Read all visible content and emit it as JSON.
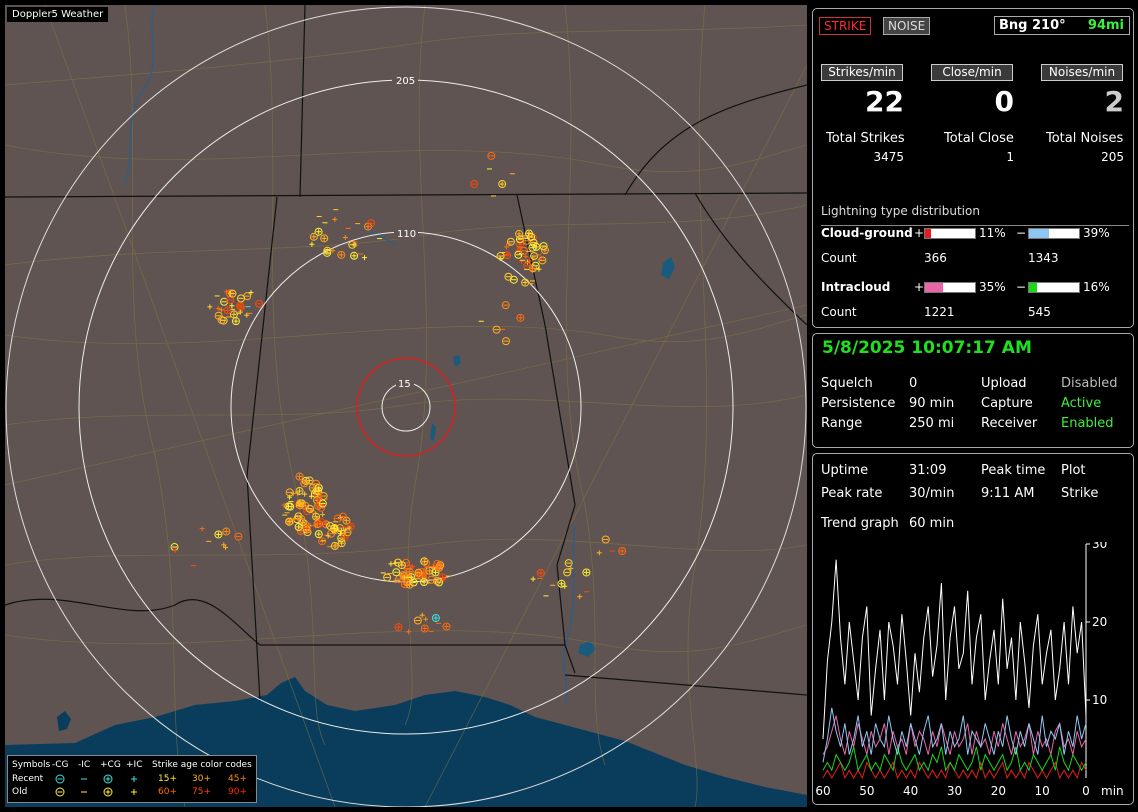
{
  "app_title": "Doppler5 Weather",
  "map": {
    "range_labels": [
      "205",
      "110",
      "15"
    ],
    "legend": {
      "symbols_label": "Symbols",
      "col_heads": [
        "-CG",
        "-IC",
        "+CG",
        "+IC"
      ],
      "age_title": "Strike age color codes",
      "recent_label": "Recent",
      "old_label": "Old",
      "recent_ages": [
        "15+",
        "30+",
        "45+"
      ],
      "old_ages": [
        "60+",
        "75+",
        "90+"
      ],
      "age_colors": [
        "#ffee33",
        "#ffb020",
        "#ff8a1a",
        "#ff6a10",
        "#ff4a08",
        "#ff2a00"
      ]
    }
  },
  "top": {
    "strike_label": "STRIKE",
    "noise_label": "NOISE",
    "bearing": "Bng 210°",
    "distance": "94mi"
  },
  "rates": {
    "strikes_per_min_label": "Strikes/min",
    "close_per_min_label": "Close/min",
    "noises_per_min_label": "Noises/min",
    "strikes_per_min": "22",
    "close_per_min": "0",
    "noises_per_min": "2"
  },
  "totals": {
    "strikes_label": "Total Strikes",
    "strikes": "3475",
    "close_label": "Total Close",
    "close": "1",
    "noises_label": "Total Noises",
    "noises": "205"
  },
  "distribution": {
    "title": "Lightning type distribution",
    "cg_label": "Cloud-ground",
    "ic_label": "Intracloud",
    "count_label": "Count",
    "plus": "+",
    "minus": "−",
    "cg_pos_pct": "11%",
    "cg_neg_pct": "39%",
    "cg_pos_count": "366",
    "cg_neg_count": "1343",
    "ic_pos_pct": "35%",
    "ic_neg_pct": "16%",
    "ic_pos_count": "1221",
    "ic_neg_count": "545",
    "cg_pos_frac": 0.11,
    "cg_neg_frac": 0.39,
    "ic_pos_frac": 0.35,
    "ic_neg_frac": 0.16,
    "colors": {
      "cg_pos": "#e81c1c",
      "cg_neg": "#8ec8f2",
      "ic_pos": "#e866a8",
      "ic_neg": "#18d818"
    }
  },
  "status": {
    "datetime": "5/8/2025 10:07:17 AM",
    "squelch_label": "Squelch",
    "squelch": "0",
    "persistence_label": "Persistence",
    "persistence": "90 min",
    "range_label": "Range",
    "range": "250 mi",
    "upload_label": "Upload",
    "upload": "Disabled",
    "capture_label": "Capture",
    "capture": "Active",
    "receiver_label": "Receiver",
    "receiver": "Enabled"
  },
  "stats": {
    "uptime_label": "Uptime",
    "uptime": "31:09",
    "peak_time_label": "Peak time",
    "peak_time": "9:11 AM",
    "plot_label": "Plot",
    "plot": "Strike",
    "peak_rate_label": "Peak rate",
    "peak_rate": "30/min",
    "trend_label": "Trend graph",
    "trend_window": "60 min"
  },
  "chart_data": {
    "type": "line",
    "x": [
      60,
      59,
      58,
      57,
      56,
      55,
      54,
      53,
      52,
      51,
      50,
      49,
      48,
      47,
      46,
      45,
      44,
      43,
      42,
      41,
      40,
      39,
      38,
      37,
      36,
      35,
      34,
      33,
      32,
      31,
      30,
      29,
      28,
      27,
      26,
      25,
      24,
      23,
      22,
      21,
      20,
      19,
      18,
      17,
      16,
      15,
      14,
      13,
      12,
      11,
      10,
      9,
      8,
      7,
      6,
      5,
      4,
      3,
      2,
      1,
      0
    ],
    "xticks": [
      60,
      50,
      40,
      30,
      20,
      10,
      0
    ],
    "x_unit": "min",
    "yticks": [
      10,
      20,
      30
    ],
    "ylim": [
      0,
      30
    ],
    "series": [
      {
        "color": "#ffffff",
        "values": [
          5,
          15,
          20,
          28,
          18,
          12,
          20,
          15,
          10,
          18,
          22,
          8,
          14,
          19,
          10,
          20,
          17,
          12,
          21,
          15,
          8,
          16,
          11,
          18,
          22,
          13,
          17,
          25,
          10,
          18,
          22,
          14,
          16,
          24,
          12,
          18,
          21,
          10,
          15,
          19,
          12,
          23,
          14,
          18,
          10,
          20,
          15,
          9,
          17,
          21,
          12,
          16,
          19,
          10,
          14,
          20,
          12,
          22,
          16,
          20,
          8
        ]
      },
      {
        "color": "#8ec8f2",
        "values": [
          2,
          5,
          9,
          6,
          4,
          7,
          3,
          5,
          8,
          4,
          6,
          3,
          7,
          5,
          4,
          8,
          5,
          3,
          6,
          4,
          7,
          5,
          3,
          6,
          8,
          4,
          5,
          7,
          3,
          6,
          4,
          5,
          8,
          3,
          6,
          5,
          4,
          7,
          5,
          3,
          6,
          4,
          8,
          5,
          3,
          6,
          4,
          7,
          5,
          3,
          8,
          4,
          6,
          5,
          7,
          3,
          6,
          4,
          8,
          5,
          7
        ]
      },
      {
        "color": "#e866a8",
        "values": [
          3,
          4,
          6,
          8,
          5,
          3,
          6,
          4,
          7,
          5,
          3,
          6,
          4,
          5,
          7,
          3,
          6,
          4,
          5,
          3,
          7,
          4,
          6,
          5,
          3,
          6,
          4,
          7,
          5,
          3,
          6,
          4,
          5,
          7,
          3,
          6,
          4,
          5,
          3,
          6,
          4,
          7,
          5,
          3,
          6,
          4,
          5,
          7,
          3,
          6,
          4,
          5,
          3,
          6,
          7,
          4,
          5,
          3,
          6,
          4,
          5
        ]
      },
      {
        "color": "#18d818",
        "values": [
          1,
          2,
          1,
          3,
          2,
          1,
          2,
          4,
          1,
          2,
          3,
          1,
          2,
          1,
          3,
          2,
          1,
          4,
          2,
          1,
          2,
          3,
          1,
          2,
          1,
          3,
          2,
          4,
          1,
          2,
          1,
          3,
          2,
          1,
          2,
          4,
          1,
          3,
          2,
          1,
          2,
          3,
          1,
          2,
          4,
          1,
          2,
          1,
          3,
          2,
          1,
          2,
          3,
          1,
          4,
          2,
          1,
          3,
          2,
          1,
          2
        ]
      },
      {
        "color": "#e81c1c",
        "values": [
          0,
          1,
          0,
          1,
          2,
          0,
          1,
          0,
          1,
          0,
          2,
          1,
          0,
          1,
          0,
          1,
          2,
          0,
          1,
          0,
          1,
          0,
          2,
          1,
          0,
          1,
          0,
          1,
          0,
          2,
          1,
          0,
          1,
          0,
          1,
          0,
          2,
          0,
          1,
          0,
          1,
          2,
          0,
          1,
          0,
          1,
          0,
          2,
          1,
          0,
          1,
          0,
          1,
          2,
          0,
          1,
          0,
          1,
          0,
          2,
          1
        ]
      }
    ]
  }
}
